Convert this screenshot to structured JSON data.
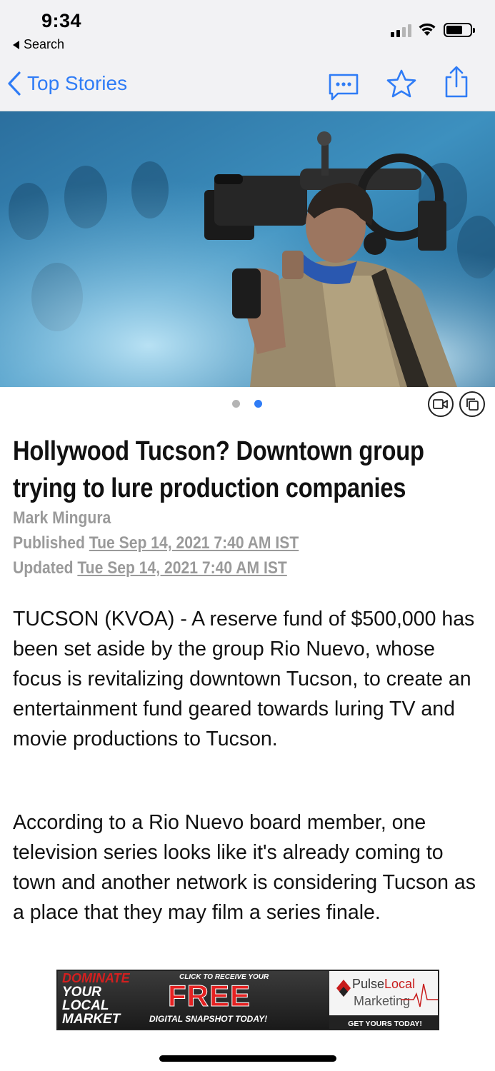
{
  "status_bar": {
    "time": "9:34",
    "back_app_label": "Search"
  },
  "nav": {
    "back_label": "Top Stories",
    "accent_color": "#2f7cf6",
    "icons": [
      "chevron-left-icon",
      "comment-icon",
      "star-icon",
      "share-icon"
    ]
  },
  "hero": {
    "description_icons": [
      "video-icon",
      "gallery-icon"
    ],
    "page_count": 2,
    "active_page": 2
  },
  "article": {
    "headline": "Hollywood Tucson? Downtown group trying to lure production companies",
    "author": "Mark Mingura",
    "published_label": "Published",
    "published_date": "Tue Sep 14, 2021 7:40 AM IST",
    "updated_label": "Updated",
    "updated_date": "Tue Sep 14, 2021 7:40 AM IST",
    "paragraphs": [
      "TUCSON (KVOA) - A reserve fund of $500,000 has been set aside by the group Rio Nuevo, whose focus is revitalizing downtown Tucson, to create an entertainment fund geared towards luring TV and movie productions to Tucson.",
      "According to a Rio Nuevo board member, one television series looks like it's already coming to town and another network is considering Tucson as a place that they may film a series finale."
    ]
  },
  "ad": {
    "dominate": "DOMINATE",
    "your": "YOUR",
    "local": "LOCAL",
    "market": "MARKET",
    "click_text": "CLICK TO RECEIVE YOUR",
    "free": "FREE",
    "digital_text": "DIGITAL SNAPSHOT TODAY!",
    "brand_pulse": "Pulse",
    "brand_local": "Local",
    "brand_marketing": "Marketing",
    "cta": "GET YOURS TODAY!"
  }
}
